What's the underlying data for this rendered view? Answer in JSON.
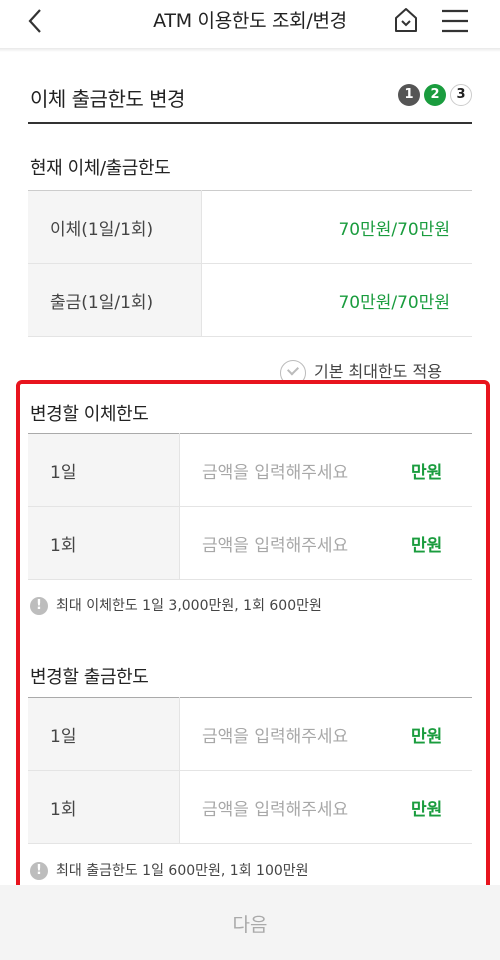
{
  "header": {
    "title": "ATM 이용한도 조회/변경"
  },
  "section": {
    "title": "이체 출금한도 변경",
    "steps": [
      "1",
      "2",
      "3"
    ]
  },
  "current": {
    "title": "현재 이체/출금한도",
    "rows": [
      {
        "label": "이체(1일/1회)",
        "value": "70만원/70만원"
      },
      {
        "label": "출금(1일/1회)",
        "value": "70만원/70만원"
      }
    ]
  },
  "max_check": {
    "label": "기본 최대한도 적용"
  },
  "transfer": {
    "title": "변경할 이체한도",
    "rows": [
      {
        "label": "1일",
        "placeholder": "금액을 입력해주세요",
        "unit": "만원"
      },
      {
        "label": "1회",
        "placeholder": "금액을 입력해주세요",
        "unit": "만원"
      }
    ],
    "notice": "최대 이체한도 1일 3,000만원, 1회 600만원"
  },
  "withdraw": {
    "title": "변경할 출금한도",
    "rows": [
      {
        "label": "1일",
        "placeholder": "금액을 입력해주세요",
        "unit": "만원"
      },
      {
        "label": "1회",
        "placeholder": "금액을 입력해주세요",
        "unit": "만원"
      }
    ],
    "notice": "최대 출금한도 1일 600만원, 1회 100만원"
  },
  "footer": {
    "next_label": "다음"
  },
  "colors": {
    "accent": "#1a9c3e",
    "highlight": "#e8141e"
  },
  "icons": [
    "back-icon",
    "home-icon",
    "menu-icon",
    "check-icon",
    "info-icon"
  ]
}
